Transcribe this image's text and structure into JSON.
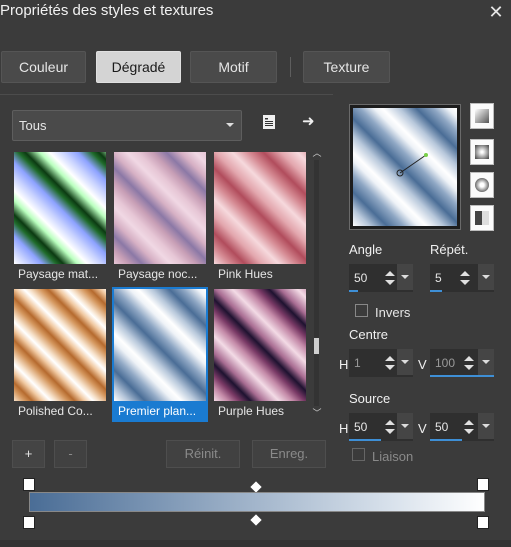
{
  "window": {
    "title": "Propriétés des styles et textures",
    "close_glyph": "✕"
  },
  "tabs": [
    {
      "label": "Couleur",
      "active": false
    },
    {
      "label": "Dégradé",
      "active": true
    },
    {
      "label": "Motif",
      "active": false
    },
    {
      "label": "Texture",
      "active": false
    }
  ],
  "category": {
    "value": "Tous"
  },
  "swatches": [
    {
      "label": "Paysage mat...",
      "selected": false
    },
    {
      "label": "Paysage noc...",
      "selected": false
    },
    {
      "label": "Pink Hues",
      "selected": false
    },
    {
      "label": "Polished Co...",
      "selected": false
    },
    {
      "label": "Premier plan...",
      "selected": true
    },
    {
      "label": "Purple Hues",
      "selected": false
    }
  ],
  "buttons": {
    "add": "+",
    "remove": "-",
    "reset": "Réinit.",
    "save": "Enreg."
  },
  "fields": {
    "angle": {
      "label": "Angle",
      "value": "50"
    },
    "repeat": {
      "label": "Répét.",
      "value": "5"
    },
    "invert": {
      "label": "Invers",
      "checked": false
    },
    "center": {
      "label": "Centre",
      "h_label": "H",
      "h_value": "1",
      "v_label": "V",
      "v_value": "100"
    },
    "source": {
      "label": "Source",
      "h_label": "H",
      "h_value": "50",
      "v_label": "V",
      "v_value": "50"
    },
    "link": {
      "label": "Liaison",
      "checked": false
    }
  },
  "icons": {
    "close": "close-icon",
    "dropdown": "chevron-down-icon",
    "library": "document-icon",
    "arrow": "arrow-right-icon",
    "scroll_up": "scroll-up-icon",
    "scroll_down": "scroll-down-icon"
  },
  "glyphs": {
    "arrow": "➜",
    "scroll_up": "︿",
    "scroll_down": "﹀"
  },
  "colors": {
    "accent": "#1a7bd1",
    "gradient_start": "#4a6d96",
    "gradient_end": "#ffffff"
  }
}
